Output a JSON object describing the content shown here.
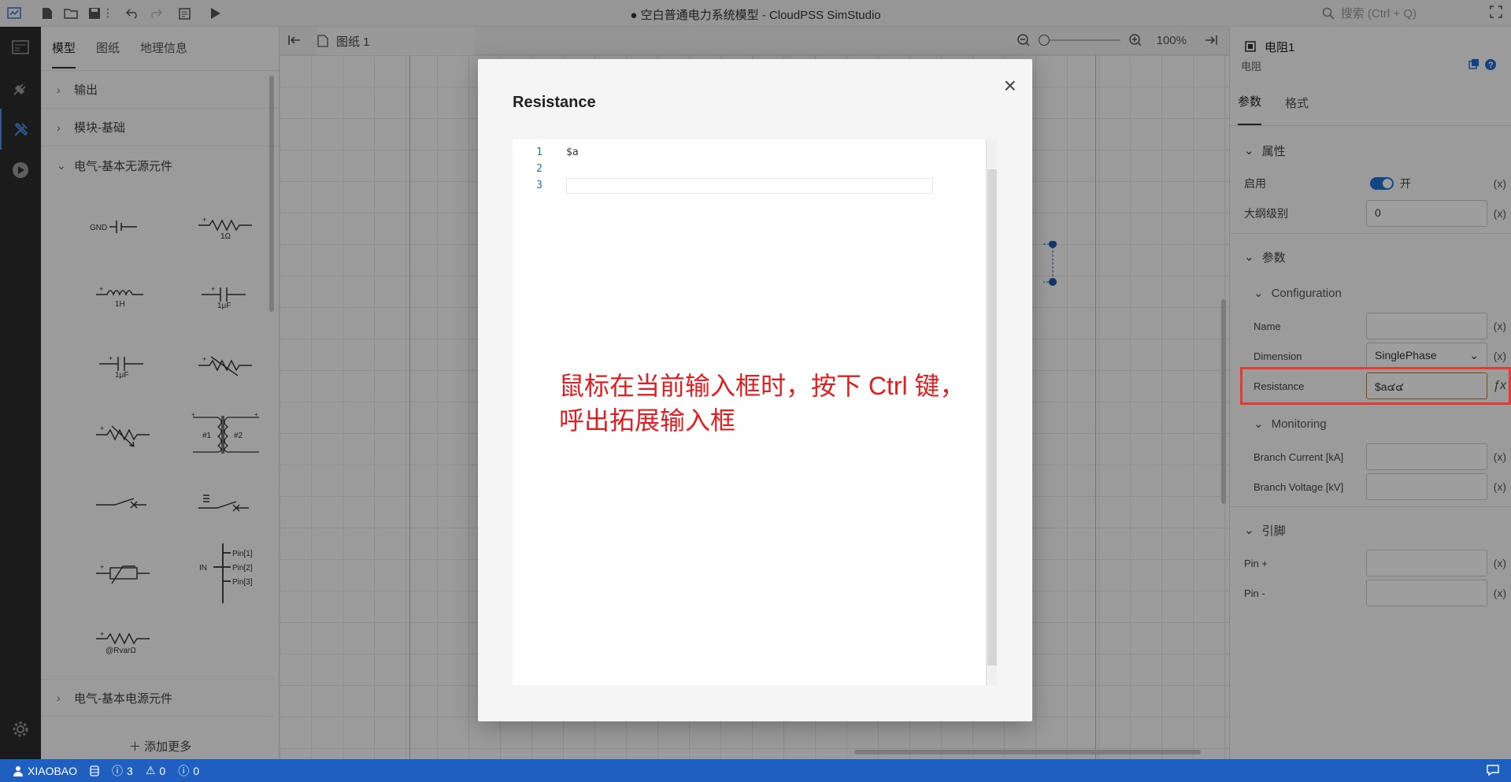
{
  "titlebar": {
    "title": "● 空白普通电力系统模型 - CloudPSS SimStudio",
    "search_placeholder": "搜索 (Ctrl + Q)"
  },
  "left_panel": {
    "tabs": [
      "模型",
      "图纸",
      "地理信息"
    ],
    "groups_top": [
      "输出",
      "模块-基础"
    ],
    "open_group": "电气-基本无源元件",
    "components": [
      {
        "icon": "ground-icon",
        "label": "GND"
      },
      {
        "icon": "resistor-icon",
        "label": "1Ω"
      },
      {
        "icon": "inductor-icon",
        "label": "1H"
      },
      {
        "icon": "capacitor-icon",
        "label": "1μF"
      },
      {
        "icon": "polarized-capacitor-icon",
        "label": "1μF"
      },
      {
        "icon": "variable-resistor-icon",
        "label": ""
      },
      {
        "icon": "variable-resistor-2-icon",
        "label": ""
      },
      {
        "icon": "transformer-icon",
        "label": "#1 #2"
      },
      {
        "icon": "breaker-icon",
        "label": ""
      },
      {
        "icon": "breaker-controlled-icon",
        "label": ""
      },
      {
        "icon": "varistor-icon",
        "label": ""
      },
      {
        "icon": "bus-pins-icon",
        "label": "IN Pin[1] Pin[2] Pin[3]"
      },
      {
        "icon": "rvar-resistor-icon",
        "label": "@RvarΩ"
      }
    ],
    "groups_bottom": [
      "电气-基本电源元件"
    ],
    "add_more": "添加更多"
  },
  "editor_tabs": {
    "tab_label": "图纸 1",
    "zoom_level": "100%"
  },
  "right_panel": {
    "component_name": "电阻1",
    "component_type": "电阻",
    "tabs": [
      "参数",
      "格式"
    ],
    "section_properties": "属性",
    "enabled_label": "启用",
    "enabled_value": "开",
    "outline_label": "大纲级别",
    "outline_value": "0",
    "section_params": "参数",
    "subsection_config": "Configuration",
    "name_label": "Name",
    "name_value": "",
    "dimension_label": "Dimension",
    "dimension_value": "SinglePhase",
    "resistance_label": "Resistance",
    "resistance_value": "$a๔๔",
    "subsection_monitoring": "Monitoring",
    "branch_current_label": "Branch Current [kA]",
    "branch_voltage_label": "Branch Voltage [kV]",
    "section_pins": "引脚",
    "pin_plus_label": "Pin +",
    "pin_minus_label": "Pin -",
    "x_button": "(x)"
  },
  "modal": {
    "title": "Resistance",
    "lines": [
      {
        "num": "1",
        "code": "$a"
      },
      {
        "num": "2",
        "code": ""
      },
      {
        "num": "3",
        "code": ""
      }
    ],
    "annotation_line1": "鼠标在当前输入框时，按下 Ctrl 键，",
    "annotation_line2": "呼出拓展输入框",
    "annotation_color": "#e02020"
  },
  "statusbar": {
    "user": "XIAOBAO",
    "errors": "3",
    "warnings": "0",
    "infos": "0",
    "color": "#1f5fbf"
  }
}
